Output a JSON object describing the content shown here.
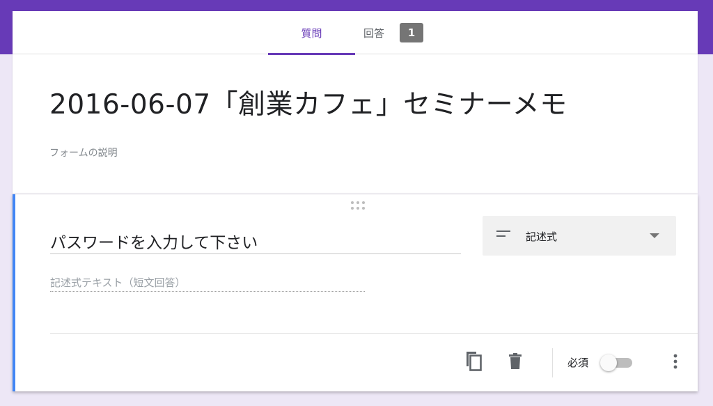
{
  "tabs": {
    "questions_label": "質問",
    "responses_label": "回答",
    "responses_count": "1"
  },
  "form": {
    "title": "2016-06-07「創業カフェ」セミナーメモ",
    "description_placeholder": "フォームの説明"
  },
  "question": {
    "title": "パスワードを入力して下さい",
    "type_label": "記述式",
    "answer_placeholder": "記述式テキスト（短文回答）",
    "required_label": "必須",
    "required": false
  },
  "colors": {
    "accent": "#673ab7",
    "background": "#ede7f6",
    "active_card_border": "#4285f4"
  },
  "icons": {
    "type": "short-text-icon",
    "dropdown": "arrow-drop-down-icon",
    "copy": "copy-icon",
    "delete": "trash-icon",
    "more": "more-vert-icon",
    "drag": "drag-handle-icon"
  }
}
